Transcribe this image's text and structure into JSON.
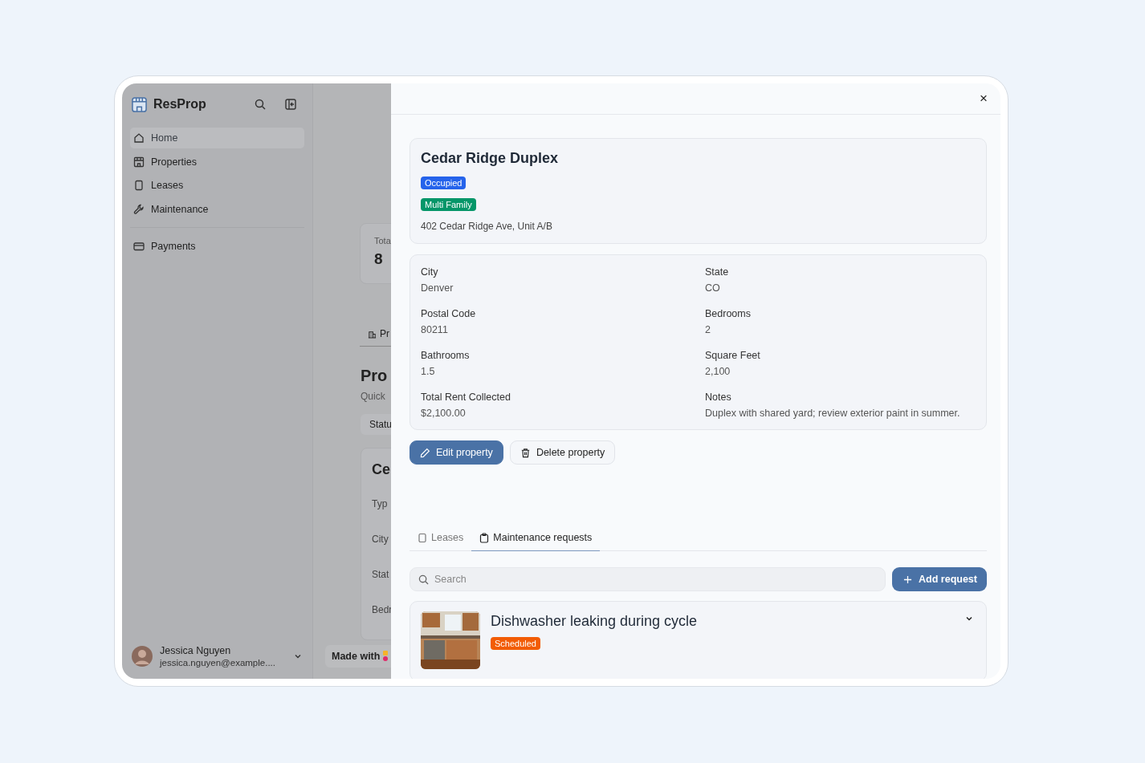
{
  "sidebar": {
    "brand": "ResProp",
    "items": [
      {
        "label": "Home",
        "kind": "home",
        "selected": true
      },
      {
        "label": "Properties",
        "kind": "building",
        "selected": false
      },
      {
        "label": "Leases",
        "kind": "doc",
        "selected": false
      },
      {
        "label": "Maintenance",
        "kind": "wrench",
        "selected": false
      }
    ],
    "secondary": [
      {
        "label": "Payments",
        "kind": "card",
        "selected": false
      }
    ],
    "user": {
      "name": "Jessica Nguyen",
      "email": "jessica.nguyen@example...."
    }
  },
  "background": {
    "stat_label": "Tota",
    "stat_value": "8",
    "tab": "Pr",
    "heading": "Pro",
    "subheading": "Quick",
    "filter": "Statu",
    "card_title": "Ce",
    "fields": [
      "Typ",
      "City",
      "Stat",
      "Bedr"
    ],
    "made_with": "Made with"
  },
  "drawer": {
    "close": "×",
    "property": {
      "title": "Cedar Ridge Duplex",
      "tags": [
        {
          "label": "Occupied",
          "color": "#2563eb"
        },
        {
          "label": "Multi Family",
          "color": "#059669"
        }
      ],
      "address": "402 Cedar Ridge Ave, Unit A/B"
    },
    "details": [
      {
        "label": "City",
        "value": "Denver"
      },
      {
        "label": "State",
        "value": "CO"
      },
      {
        "label": "Postal Code",
        "value": "80211"
      },
      {
        "label": "Bedrooms",
        "value": "2"
      },
      {
        "label": "Bathrooms",
        "value": "1.5"
      },
      {
        "label": "Square Feet",
        "value": "2,100"
      },
      {
        "label": "Total Rent Collected",
        "value": "$2,100.00"
      },
      {
        "label": "Notes",
        "value": "Duplex with shared yard; review exterior paint in summer."
      }
    ],
    "actions": [
      {
        "label": "Edit property",
        "kind": "primary"
      },
      {
        "label": "Delete property",
        "kind": "secondary"
      }
    ],
    "tabs": [
      {
        "label": "Leases",
        "kind": "doc",
        "selected": false
      },
      {
        "label": "Maintenance requests",
        "kind": "clipboard",
        "selected": true
      }
    ],
    "search": {
      "placeholder": "Search"
    },
    "add_button": "Add request",
    "requests": [
      {
        "title": "Dishwasher leaking during cycle",
        "kind": "picture",
        "tags": [
          {
            "label": "Scheduled",
            "color": "#f25c05"
          }
        ]
      }
    ]
  }
}
